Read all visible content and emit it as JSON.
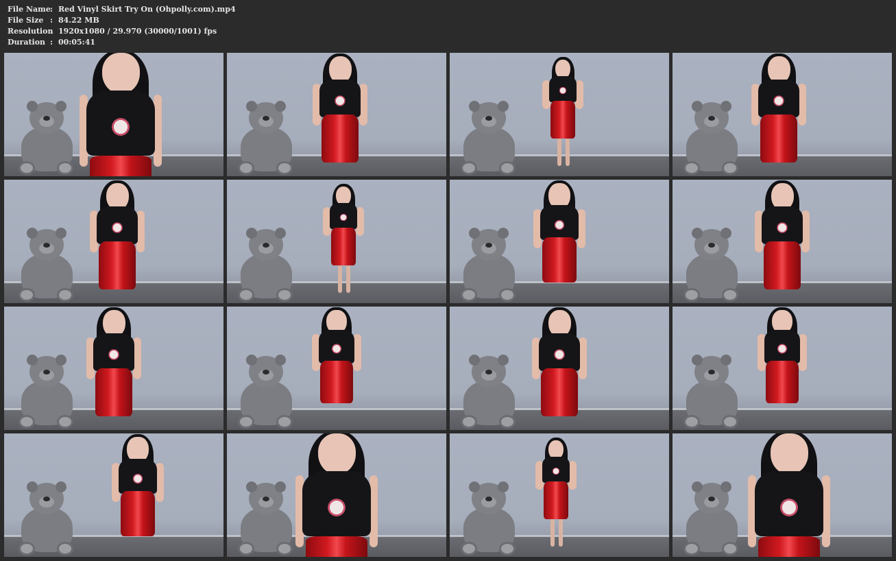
{
  "file_info": {
    "rows": [
      {
        "label": "File Name",
        "value": "Red Vinyl Skirt Try On (Ohpolly.com).mp4"
      },
      {
        "label": "File Size",
        "value": "84.22 MB"
      },
      {
        "label": "Resolution",
        "value": "1920x1080 / 29.970 (30000/1001) fps"
      },
      {
        "label": "Duration",
        "value": "00:05:41"
      }
    ],
    "separator": ":"
  },
  "thumbnails": {
    "columns": 4,
    "rows": 4,
    "count": 16
  },
  "colors": {
    "background": "#2b2b2b",
    "text": "#e6e6e6",
    "skirt": "#d01a20"
  }
}
